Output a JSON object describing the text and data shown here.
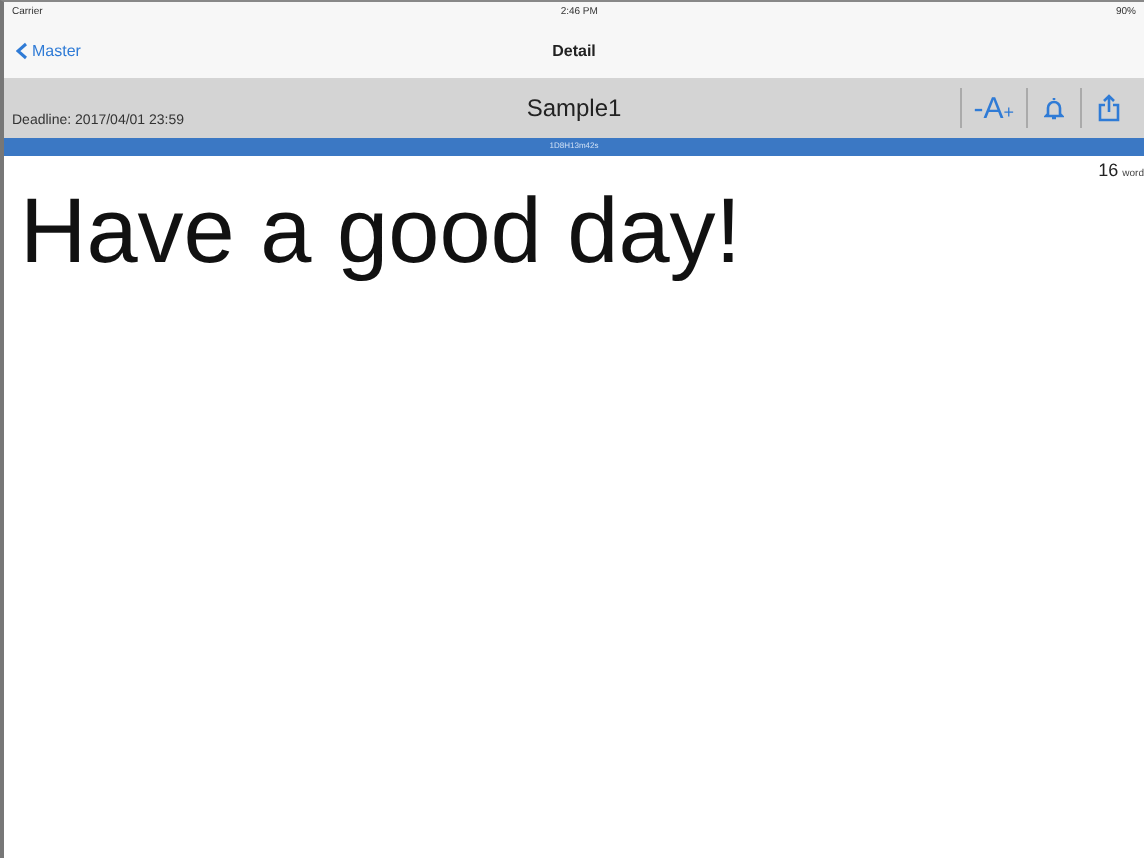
{
  "status_bar": {
    "carrier": "Carrier",
    "time": "2:46 PM",
    "battery": "90%"
  },
  "nav": {
    "back": "Master",
    "title": "Detail"
  },
  "toolbar": {
    "deadline_label": "Deadline:",
    "deadline": "2017/04/01 23:59",
    "title": "Sample1",
    "font_minus": "-",
    "font_label": "A",
    "font_plus": "+"
  },
  "progress": {
    "level": 1,
    "remaining": "1D8H13m42s"
  },
  "word_count": {
    "count": "16",
    "unit": "word"
  },
  "body": "Have a good day!"
}
